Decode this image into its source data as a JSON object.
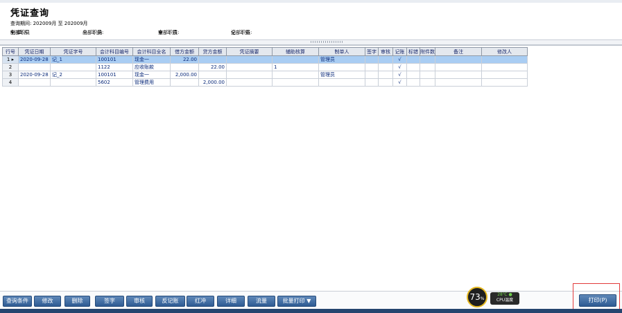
{
  "page": {
    "title": "凭证查询",
    "period_label": "查询期间:",
    "period_from": "202009月",
    "period_to_word": "至",
    "period_to": "202009月"
  },
  "filters": [
    {
      "label": "制 单 人:",
      "value": "全部职员"
    },
    {
      "label": "出　　纳:",
      "value": "全部职员"
    },
    {
      "label": "审　　核:",
      "value": "全部职员"
    },
    {
      "label": "记　　账:",
      "value": "全部职员"
    }
  ],
  "table": {
    "columns": [
      "行号",
      "凭证日期",
      "凭证字号",
      "会计科目编号",
      "会计科目全名",
      "借方金额",
      "贷方金额",
      "凭证摘要",
      "辅助核算",
      "制单人",
      "签字",
      "审核",
      "记账",
      "标错",
      "附件数",
      "备注",
      "修改人"
    ],
    "rows": [
      {
        "row": "1",
        "date": "2020-09-28",
        "voucher": "记_1",
        "code": "100101",
        "name": "现金一",
        "debit": "22.00",
        "credit": "",
        "summary": "",
        "aux": "",
        "maker": "管理员",
        "sign": "",
        "audit": "",
        "post": "√",
        "err": "",
        "attach": "",
        "note": "",
        "modifier": "",
        "selected": true
      },
      {
        "row": "2",
        "date": "",
        "voucher": "",
        "code": "1122",
        "name": "应收账款",
        "debit": "",
        "credit": "22.00",
        "summary": "",
        "aux": "1",
        "maker": "",
        "sign": "",
        "audit": "",
        "post": "√",
        "err": "",
        "attach": "",
        "note": "",
        "modifier": "",
        "selected": false
      },
      {
        "row": "3",
        "date": "2020-09-28",
        "voucher": "记_2",
        "code": "100101",
        "name": "现金一",
        "debit": "2,000.00",
        "credit": "",
        "summary": "",
        "aux": "",
        "maker": "管理员",
        "sign": "",
        "audit": "",
        "post": "√",
        "err": "",
        "attach": "",
        "note": "",
        "modifier": "",
        "selected": false
      },
      {
        "row": "4",
        "date": "",
        "voucher": "",
        "code": "5602",
        "name": "管理费用",
        "debit": "",
        "credit": "2,000.00",
        "summary": "",
        "aux": "",
        "maker": "",
        "sign": "",
        "audit": "",
        "post": "√",
        "err": "",
        "attach": "",
        "note": "",
        "modifier": "",
        "selected": false
      }
    ]
  },
  "toolbar": {
    "buttons": [
      "查询条件",
      "修改",
      "删除",
      "签字",
      "审核",
      "反记账",
      "红冲",
      "详细",
      "流量",
      "批量打印"
    ],
    "batch_arrow": "▼",
    "print": "打印(P)"
  },
  "monitor": {
    "cpu_percent": "73",
    "percent_sign": "%",
    "temperature": "28℃",
    "temperature_label": "CPU温度"
  },
  "colors": {
    "selected_row": "#a9cdf3",
    "button": "#2e5b93",
    "highlight_box": "#e23a3a",
    "monitor_ring": "#e5b820"
  }
}
